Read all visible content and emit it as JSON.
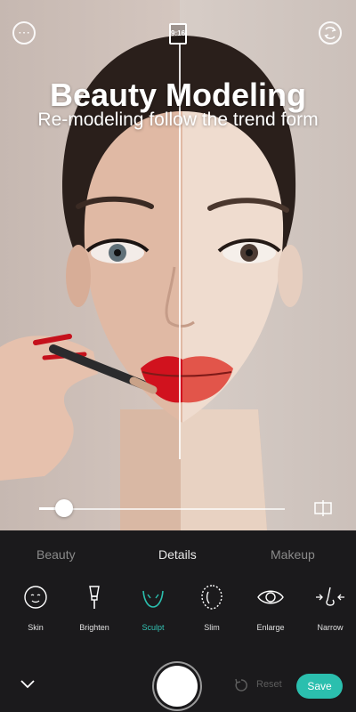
{
  "top_bar": {
    "ratio_label": "9:16"
  },
  "hero": {
    "title": "Beauty Modeling",
    "subtitle": "Re-modeling follow the trend form"
  },
  "slider": {
    "level": 0.1
  },
  "tabs": [
    {
      "label": "Beauty",
      "active": false
    },
    {
      "label": "Details",
      "active": true
    },
    {
      "label": "Makeup",
      "active": false
    }
  ],
  "tools": [
    {
      "label": "Skin",
      "icon": "face-smile-icon"
    },
    {
      "label": "Brighten",
      "icon": "brush-icon"
    },
    {
      "label": "Sculpt",
      "icon": "jaw-icon",
      "active": true
    },
    {
      "label": "Slim",
      "icon": "face-outline-icon"
    },
    {
      "label": "Enlarge",
      "icon": "eye-icon"
    },
    {
      "label": "Narrow",
      "icon": "nose-icon"
    }
  ],
  "bottom": {
    "reset_label": "Reset",
    "save_label": "Save"
  },
  "colors": {
    "accent": "#2bbfae",
    "panel_bg": "#1b1a1c"
  }
}
